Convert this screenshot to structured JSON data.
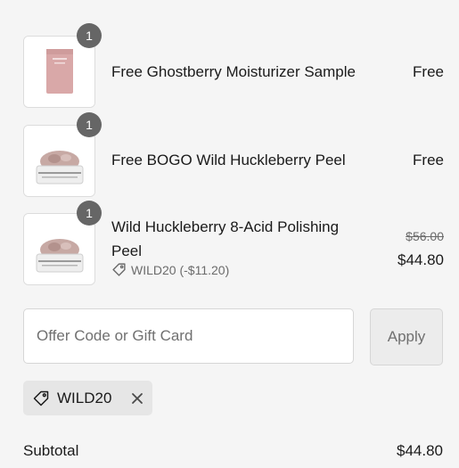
{
  "line_items": [
    {
      "quantity": "1",
      "name": "Free Ghostberry Moisturizer Sample",
      "price": "Free"
    },
    {
      "quantity": "1",
      "name": "Free BOGO Wild Huckleberry Peel",
      "price": "Free"
    },
    {
      "quantity": "1",
      "name_line1": "Wild Huckleberry 8-Acid Polishing",
      "name_line2": "Peel",
      "original_price": "$56.00",
      "price": "$44.80",
      "discount_label": "WILD20 (-$11.20)"
    }
  ],
  "discount_form": {
    "placeholder": "Offer Code or Gift Card",
    "value": "",
    "apply_label": "Apply"
  },
  "applied_code": {
    "code": "WILD20"
  },
  "summary": {
    "subtotal_label": "Subtotal",
    "subtotal_value": "$44.80"
  },
  "icons": {
    "tag": "tag-icon",
    "remove": "close-icon"
  },
  "colors": {
    "background": "#f5f5f5",
    "badge": "#666666",
    "muted_text": "#6b6b6b"
  }
}
